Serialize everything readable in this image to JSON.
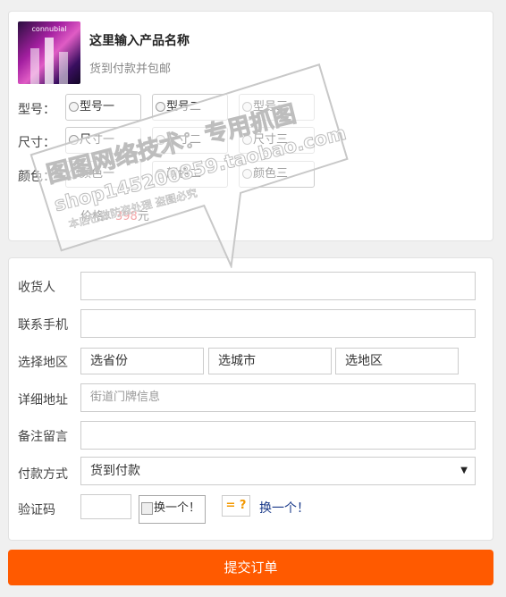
{
  "product": {
    "thumb_brand": "connubial",
    "title": "这里输入产品名称",
    "subtitle": "货到付款并包邮"
  },
  "options": {
    "model": {
      "label": "型号：",
      "items": [
        "型号一",
        "型号二",
        "型号三"
      ]
    },
    "size": {
      "label": "尺寸：",
      "items": [
        "尺寸一",
        "尺寸二",
        "尺寸三"
      ]
    },
    "color": {
      "label": "颜色：",
      "items": [
        "颜色一",
        "颜色二",
        "颜色三"
      ]
    }
  },
  "price": {
    "prefix": "价格：",
    "value": "398",
    "unit": "元"
  },
  "form": {
    "receiver_label": "收货人",
    "receiver_value": "",
    "phone_label": "联系手机",
    "phone_value": "",
    "region_label": "选择地区",
    "province": "选省份",
    "city": "选城市",
    "district": "选地区",
    "address_label": "详细地址",
    "address_placeholder": "街道门牌信息",
    "note_label": "备注留言",
    "note_value": "",
    "payment_label": "付款方式",
    "payment_value": "货到付款",
    "payment_caret": "▼",
    "captcha_label": "验证码",
    "captcha_value": "",
    "captcha_img_alt": "换一个！",
    "captcha_eq": "= ?",
    "captcha_change": "换一个！"
  },
  "submit_label": "提交订单",
  "watermark": {
    "line1": "图图网络技术：专用抓图",
    "line2": "shop145200859.taobao.com",
    "line3": "本店已做防盗处理 盗图必究"
  },
  "colors": {
    "accent": "#ff5a00",
    "price": "#e4393c",
    "captcha_eq": "#f39800",
    "link": "#1a3a8a"
  }
}
